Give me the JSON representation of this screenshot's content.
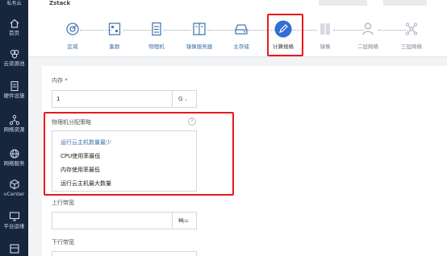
{
  "sidebar": {
    "logo": "私有云",
    "items": [
      {
        "label": "首页",
        "icon": "home-icon"
      },
      {
        "label": "云资源池",
        "icon": "cloud-icon"
      },
      {
        "label": "硬件设施",
        "icon": "server-icon"
      },
      {
        "label": "网络资源",
        "icon": "network-icon"
      },
      {
        "label": "网络服务",
        "icon": "globe-icon"
      },
      {
        "label": "vCenter",
        "icon": "cube-icon"
      },
      {
        "label": "平台运维",
        "icon": "monitor-icon"
      }
    ]
  },
  "topbar": {
    "title": "Zstack"
  },
  "steps": [
    {
      "label": "区域",
      "icon": "zone-icon",
      "state": "done"
    },
    {
      "label": "集群",
      "icon": "cluster-icon",
      "state": "done"
    },
    {
      "label": "物理机",
      "icon": "host-icon",
      "state": "done"
    },
    {
      "label": "镜像服务器",
      "icon": "image-server-icon",
      "state": "done"
    },
    {
      "label": "主存储",
      "icon": "primary-storage-icon",
      "state": "done"
    },
    {
      "label": "计算规格",
      "icon": "pencil-icon",
      "state": "active"
    },
    {
      "label": "镜像",
      "icon": "image-icon",
      "state": "future"
    },
    {
      "label": "二层网络",
      "icon": "l2-network-icon",
      "state": "future"
    },
    {
      "label": "三层网络",
      "icon": "l3-network-icon",
      "state": "future"
    }
  ],
  "form": {
    "memory": {
      "label": "内存 *",
      "value": "1",
      "unit": "G"
    },
    "allocator": {
      "label": "物理机分配策略",
      "help": "?",
      "options": [
        "运行云主机数量最少",
        "CPU使用率最低",
        "内存使用率最低",
        "运行云主机最大数量"
      ],
      "selected_index": 0
    },
    "upstream": {
      "label": "上行带宽",
      "value": "",
      "unit": "M",
      "suffix": "bps"
    },
    "downstream": {
      "label": "下行带宽"
    }
  },
  "colors": {
    "sidebar_bg": "#16263d",
    "accent": "#2f6fd6",
    "step_done": "#4a7ab0",
    "highlight": "#e8181d"
  }
}
